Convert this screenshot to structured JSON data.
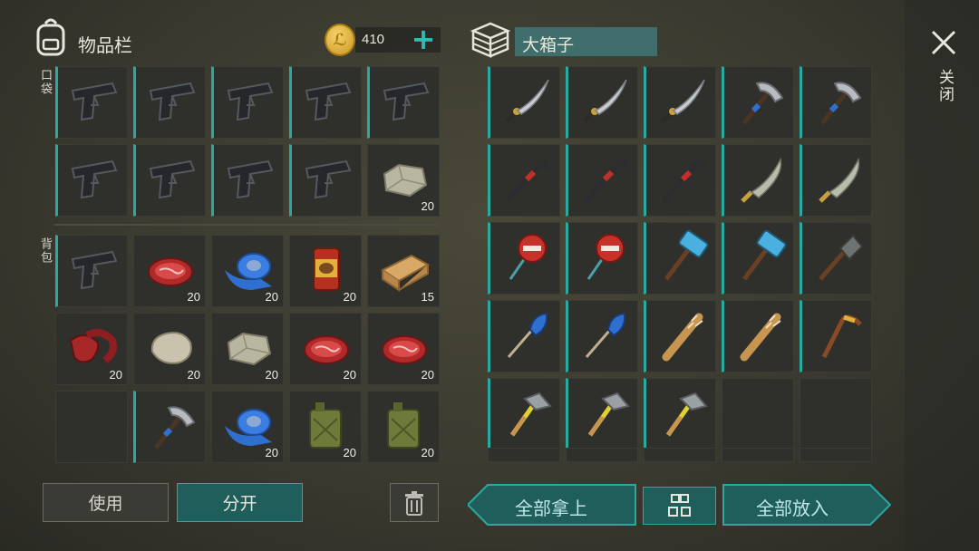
{
  "inventory": {
    "title": "物品栏",
    "coins": "410",
    "pockets_label": "口袋",
    "backpack_label": "背包"
  },
  "chest": {
    "title": "大箱子"
  },
  "close_label": "关闭",
  "buttons": {
    "use": "使用",
    "split": "分开",
    "take_all": "全部拿上",
    "put_all": "全部放入"
  },
  "colors": {
    "accent": "#2aa8a2",
    "slot_bg": "#2f302b",
    "button_teal": "#1f5e5b",
    "background": "#3a3a30"
  },
  "pockets": [
    {
      "icon": "pistol-icon",
      "qty": "",
      "durability": 1.0
    },
    {
      "icon": "pistol-icon",
      "qty": "",
      "durability": 1.0
    },
    {
      "icon": "pistol-icon",
      "qty": "",
      "durability": 1.0
    },
    {
      "icon": "pistol-icon",
      "qty": "",
      "durability": 1.0
    },
    {
      "icon": "pistol-icon",
      "qty": "",
      "durability": 1.0
    },
    {
      "icon": "pistol-icon",
      "qty": "",
      "durability": 1.0
    },
    {
      "icon": "pistol-icon",
      "qty": "",
      "durability": 1.0
    },
    {
      "icon": "pistol-icon",
      "qty": "",
      "durability": 1.0
    },
    {
      "icon": "pistol-icon",
      "qty": "",
      "durability": 1.0
    },
    {
      "icon": "limestone-icon",
      "qty": "20"
    }
  ],
  "backpack": [
    {
      "icon": "pistol-icon",
      "qty": "",
      "durability": 1.0
    },
    {
      "icon": "raw-meat-icon",
      "qty": "20"
    },
    {
      "icon": "duct-tape-icon",
      "qty": "20"
    },
    {
      "icon": "canned-food-icon",
      "qty": "20"
    },
    {
      "icon": "wood-plank-icon",
      "qty": "15"
    },
    {
      "icon": "bacon-icon",
      "qty": "20"
    },
    {
      "icon": "stone-icon",
      "qty": "20"
    },
    {
      "icon": "limestone-icon",
      "qty": "20"
    },
    {
      "icon": "raw-meat-icon",
      "qty": "20"
    },
    {
      "icon": "raw-meat-icon",
      "qty": "20"
    },
    {
      "icon": "",
      "qty": ""
    },
    {
      "icon": "pickaxe-icon",
      "qty": "",
      "durability": 0.45
    },
    {
      "icon": "duct-tape-icon",
      "qty": "20"
    },
    {
      "icon": "gas-canister-icon",
      "qty": "20"
    },
    {
      "icon": "gas-canister-icon",
      "qty": "20"
    }
  ],
  "chest_items": [
    {
      "icon": "katana-icon",
      "durability": 1.0
    },
    {
      "icon": "katana-icon",
      "durability": 1.0
    },
    {
      "icon": "katana-icon",
      "durability": 1.0
    },
    {
      "icon": "pickaxe-icon",
      "durability": 1.0
    },
    {
      "icon": "pickaxe-icon",
      "durability": 1.0
    },
    {
      "icon": "crowbar-icon",
      "durability": 1.0
    },
    {
      "icon": "crowbar-icon",
      "durability": 1.0
    },
    {
      "icon": "crowbar-icon",
      "durability": 1.0
    },
    {
      "icon": "machete-icon",
      "durability": 1.0
    },
    {
      "icon": "machete-icon",
      "durability": 1.0
    },
    {
      "icon": "stop-sign-icon",
      "durability": 1.0
    },
    {
      "icon": "stop-sign-icon",
      "durability": 1.0
    },
    {
      "icon": "sledgehammer-icon",
      "durability": 1.0
    },
    {
      "icon": "sledgehammer-icon",
      "durability": 1.0
    },
    {
      "icon": "shovel-icon",
      "durability": 1.0
    },
    {
      "icon": "oar-icon",
      "durability": 1.0
    },
    {
      "icon": "oar-icon",
      "durability": 1.0
    },
    {
      "icon": "spiked-bat-icon",
      "durability": 1.0
    },
    {
      "icon": "spiked-bat-icon",
      "durability": 1.0
    },
    {
      "icon": "hockey-stick-icon",
      "durability": 1.0
    },
    {
      "icon": "hammer-icon",
      "durability": 1.0
    },
    {
      "icon": "hammer-icon",
      "durability": 1.0
    },
    {
      "icon": "hammer-icon",
      "durability": 1.0
    },
    {
      "icon": ""
    },
    {
      "icon": ""
    }
  ]
}
